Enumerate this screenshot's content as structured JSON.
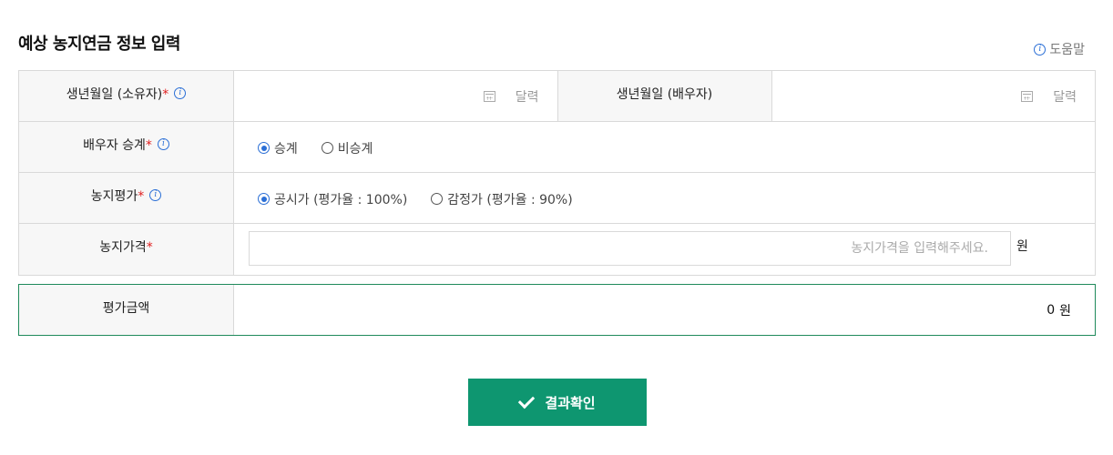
{
  "page": {
    "title": "예상 농지연금 정보 입력",
    "help_label": "도움말"
  },
  "form": {
    "birth_owner": {
      "label": "생년월일 (소유자)",
      "required_mark": "*",
      "date_button": "달력"
    },
    "birth_spouse": {
      "label": "생년월일 (배우자)",
      "date_button": "달력"
    },
    "spouse_succession": {
      "label": "배우자 승계",
      "required_mark": "*",
      "options": [
        "승계",
        "비승계"
      ],
      "selected": "승계"
    },
    "land_valuation": {
      "label": "농지평가",
      "required_mark": "*",
      "options": [
        "공시가 (평가율 : 100%)",
        "감정가 (평가율 : 90%)"
      ],
      "selected": "공시가 (평가율 : 100%)"
    },
    "land_price": {
      "label": "농지가격",
      "required_mark": "*",
      "value": "",
      "placeholder": "농지가격을 입력해주세요.",
      "unit": "원"
    }
  },
  "result": {
    "label": "평가금액",
    "amount": "0",
    "unit": "원"
  },
  "submit": {
    "label": "결과확인"
  },
  "colors": {
    "accent_blue": "#2b6fd6",
    "required_red": "#e02020",
    "button_green": "#0e9670",
    "result_border": "#1f8a5b"
  }
}
